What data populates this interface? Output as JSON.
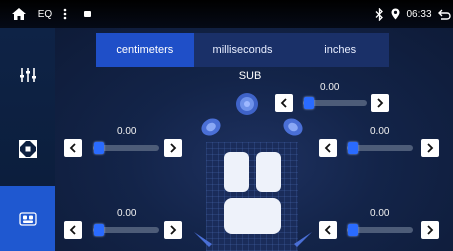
{
  "status_bar": {
    "home_icon": "home-icon",
    "app_label": "EQ",
    "time": "06:33",
    "icons": [
      "more-vert-icon",
      "notification-icon",
      "bluetooth-icon",
      "location-icon",
      "back-icon"
    ]
  },
  "sidebar": {
    "items": [
      {
        "icon": "equalizer-icon",
        "active": false
      },
      {
        "icon": "fader-balance-icon",
        "active": false
      },
      {
        "icon": "car-seat-icon",
        "active": true
      }
    ]
  },
  "tabs": [
    {
      "label": "centimeters",
      "active": true
    },
    {
      "label": "milliseconds",
      "active": false
    },
    {
      "label": "inches",
      "active": false
    }
  ],
  "sub_label": "SUB",
  "sliders": {
    "sub": {
      "value_label": "0.00",
      "level": 0
    },
    "front_left": {
      "value_label": "0.00",
      "level": 0
    },
    "front_right": {
      "value_label": "0.00",
      "level": 0
    },
    "rear_left": {
      "value_label": "0.00",
      "level": 0
    },
    "rear_right": {
      "value_label": "0.00",
      "level": 0
    }
  },
  "colors": {
    "accent": "#1f58d0",
    "background": "#0e1a33",
    "thumb": "#2a6bff"
  }
}
